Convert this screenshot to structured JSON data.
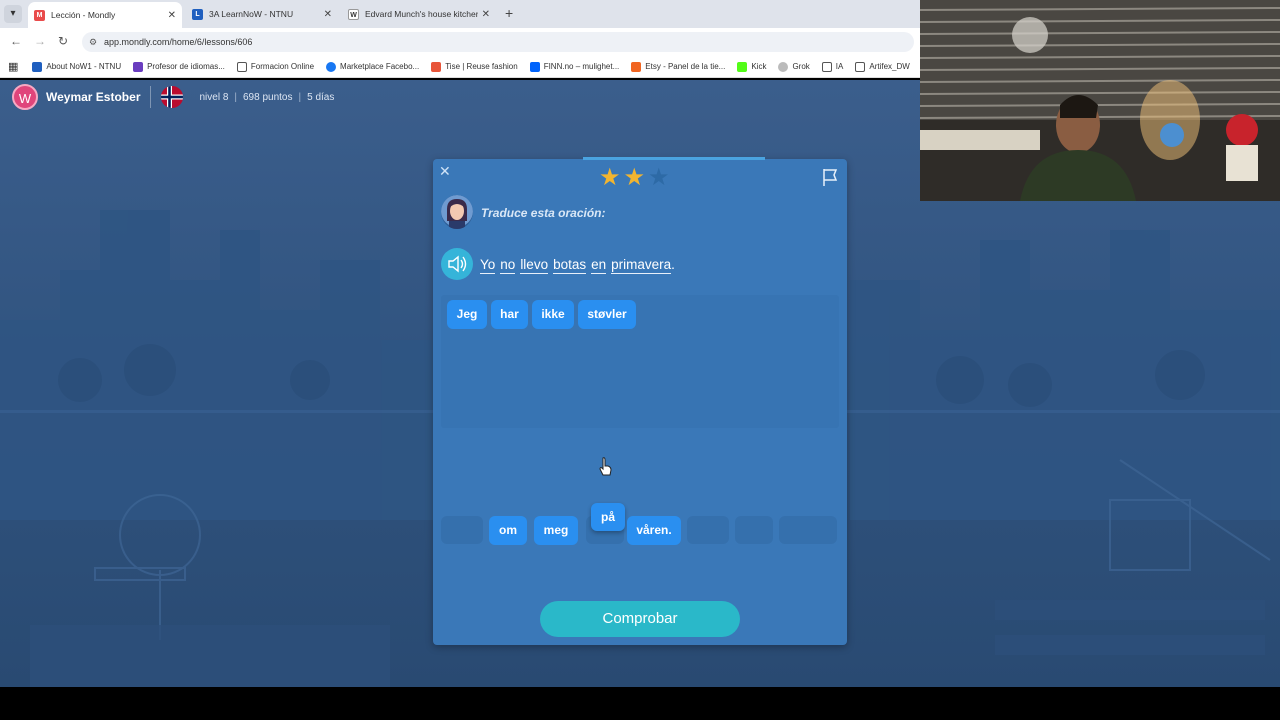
{
  "browser": {
    "tabs": [
      {
        "title": "Lección - Mondly",
        "favicon_color": "#e94b4b",
        "favicon_char": "M"
      },
      {
        "title": "3A LearnNoW - NTNU",
        "favicon_color": "#1f5fbf",
        "favicon_char": "L"
      },
      {
        "title": "Edvard Munch's house kitchen",
        "favicon_color": "#555555",
        "favicon_char": "W"
      }
    ],
    "url": "app.mondly.com/home/6/lessons/606",
    "bookmarks": [
      {
        "label": "About NoW1 - NTNU",
        "color": "#1f5fbf"
      },
      {
        "label": "Profesor de idiomas...",
        "color": "#6a3dbf"
      },
      {
        "label": "Formacion Online",
        "color": "#f0b400"
      },
      {
        "label": "Marketplace Facebo...",
        "color": "#1877f2"
      },
      {
        "label": "Tise | Reuse fashion",
        "color": "#e8553a"
      },
      {
        "label": "FINN.no – mulighet...",
        "color": "#0063fb"
      },
      {
        "label": "Etsy - Panel de la tie...",
        "color": "#f16521"
      },
      {
        "label": "Kick",
        "color": "#53fc18"
      },
      {
        "label": "Grok",
        "color": "#888888"
      },
      {
        "label": "IA",
        "color": "#f0b400"
      },
      {
        "label": "Artifex_DW",
        "color": "#f0b400"
      }
    ]
  },
  "user": {
    "initial": "W",
    "name": "Weymar Estober",
    "level": "nivel 8",
    "points": "698 puntos",
    "days": "5 días"
  },
  "lesson": {
    "stars_filled": 2,
    "stars_total": 3,
    "prompt": "Traduce esta oración:",
    "sentence_words": [
      "Yo",
      "no",
      "llevo",
      "botas",
      "en",
      "primavera"
    ],
    "sentence_end": ".",
    "answer_chips": [
      "Jeg",
      "har",
      "ikke",
      "støvler"
    ],
    "bank_chips": {
      "om": "om",
      "meg": "meg",
      "pa": "på",
      "varen": "våren."
    },
    "check_label": "Comprobar"
  },
  "colors": {
    "accent": "#2a8ff0",
    "check": "#2ab8c9",
    "star_filled": "#f2b530",
    "star_empty": "#2d6aa6"
  }
}
